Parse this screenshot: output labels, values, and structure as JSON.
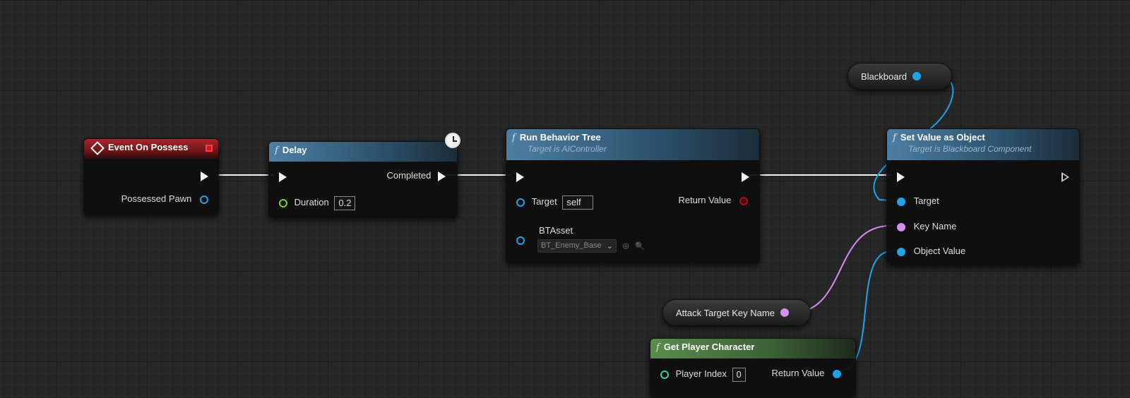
{
  "nodes": {
    "event_on_possess": {
      "title": "Event On Possess",
      "pin_possessed_pawn": "Possessed Pawn"
    },
    "delay": {
      "title": "Delay",
      "pin_completed": "Completed",
      "pin_duration": "Duration",
      "duration_value": "0.2"
    },
    "run_behavior_tree": {
      "title": "Run Behavior Tree",
      "subtitle": "Target is AIController",
      "pin_target": "Target",
      "target_value": "self",
      "pin_return_value": "Return Value",
      "pin_btasset": "BTAsset",
      "btasset_value": "BT_Enemy_Base"
    },
    "set_value_as_object": {
      "title": "Set Value as Object",
      "subtitle": "Target is Blackboard Component",
      "pin_target": "Target",
      "pin_key_name": "Key Name",
      "pin_object_value": "Object Value"
    },
    "blackboard_var": {
      "label": "Blackboard"
    },
    "attack_target_key_name_var": {
      "label": "Attack Target Key Name"
    },
    "get_player_character": {
      "title": "Get Player Character",
      "pin_player_index": "Player Index",
      "player_index_value": "0",
      "pin_return_value": "Return Value"
    }
  },
  "icons": {
    "function": "f",
    "dropdown_chevron": "⌄",
    "use_selected": "⊕",
    "browse": "🔍"
  },
  "colors": {
    "exec_wire": "#f2f2f2",
    "object_pin": "#1fa4ea",
    "name_pin": "#d58ef2",
    "float_pin": "#7fd11a",
    "event_header": "#a8262d",
    "function_header": "#4d7fa3",
    "pure_function_header": "#5a8c4d"
  }
}
